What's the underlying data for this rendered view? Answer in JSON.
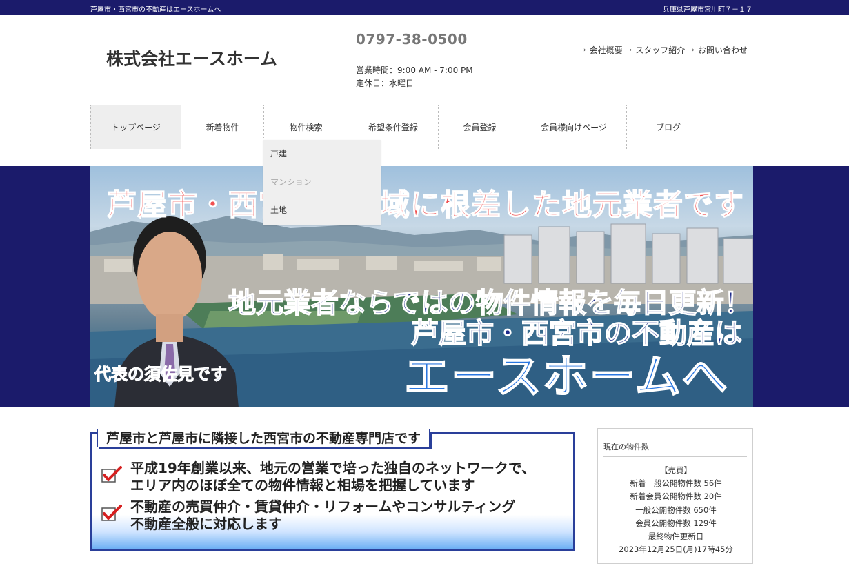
{
  "topbar": {
    "left_text": "芦屋市・西宮市の不動産はエースホームへ",
    "right_text": "兵庫県芦屋市宮川町７－１７"
  },
  "header": {
    "company_name": "株式会社エースホーム",
    "phone": "0797-38-0500",
    "hours": "営業時間：9:00 AM - 7:00 PM",
    "holiday": "定休日：水曜日",
    "links": [
      {
        "label": "会社概要",
        "icon": "chevron-right-icon"
      },
      {
        "label": "スタッフ紹介",
        "icon": "chevron-right-icon"
      },
      {
        "label": "お問い合わせ",
        "icon": "chevron-right-icon"
      }
    ]
  },
  "nav": {
    "items": [
      {
        "label": "トップページ"
      },
      {
        "label": "新着物件"
      },
      {
        "label": "物件検索"
      },
      {
        "label": "希望条件登録"
      },
      {
        "label": "会員登録"
      },
      {
        "label": "会員様向けページ"
      },
      {
        "label": "ブログ"
      }
    ],
    "dropdown": [
      {
        "label": "戸建"
      },
      {
        "label": "マンション"
      },
      {
        "label": "土地"
      }
    ]
  },
  "hero": {
    "headline": "芦屋市・西宮市の地域に根差した地元業者です",
    "line1": "地元業者ならではの物件情報を毎日更新！",
    "line2": "芦屋市・西宮市の不動産は",
    "line3": "エースホームへ",
    "caption": "代表の須佐見です"
  },
  "info": {
    "heading": "芦屋市と芦屋市に隣接した西宮市の不動産専門店です",
    "points": [
      {
        "line_a": "平成19年創業以来、地元の営業で培った独自のネットワークで、",
        "line_b": "エリア内のほぼ全ての物件情報と相場を把握しています"
      },
      {
        "line_a": "不動産の売買仲介・賃貸仲介・リフォームやコンサルティング",
        "line_b": "不動産全般に対応します"
      }
    ]
  },
  "sidebar": {
    "title": "現在の物件数",
    "lines": [
      "【売買】",
      "新着一般公開物件数 56件",
      "新着会員公開物件数 20件",
      "一般公開物件数 650件",
      "会員公開物件数 129件",
      "最終物件更新日",
      "2023年12月25日(月)17時45分"
    ]
  },
  "colors": {
    "navy": "#1b1b6b",
    "accent_blue": "#2a77e0",
    "headline_red": "#f05050",
    "check_red": "#d62020"
  }
}
